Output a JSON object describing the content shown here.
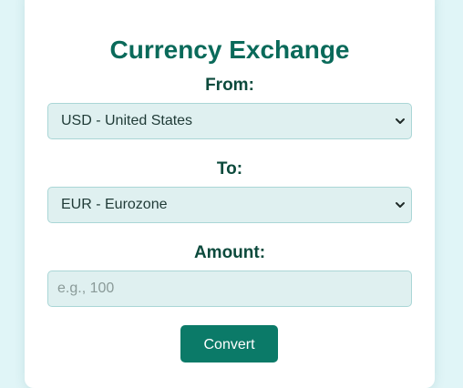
{
  "form": {
    "title": "Currency Exchange",
    "from": {
      "label": "From:",
      "selected": "USD - United States"
    },
    "to": {
      "label": "To:",
      "selected": "EUR - Eurozone"
    },
    "amount": {
      "label": "Amount:",
      "value": "",
      "placeholder": "e.g., 100"
    },
    "convert_label": "Convert"
  },
  "colors": {
    "page_background": "#e0f5f7",
    "title": "#0a6a5a",
    "field_background": "#dff0f0",
    "button": "#0b7a68"
  },
  "icons": {
    "select_arrow": "chevron-down-icon"
  }
}
